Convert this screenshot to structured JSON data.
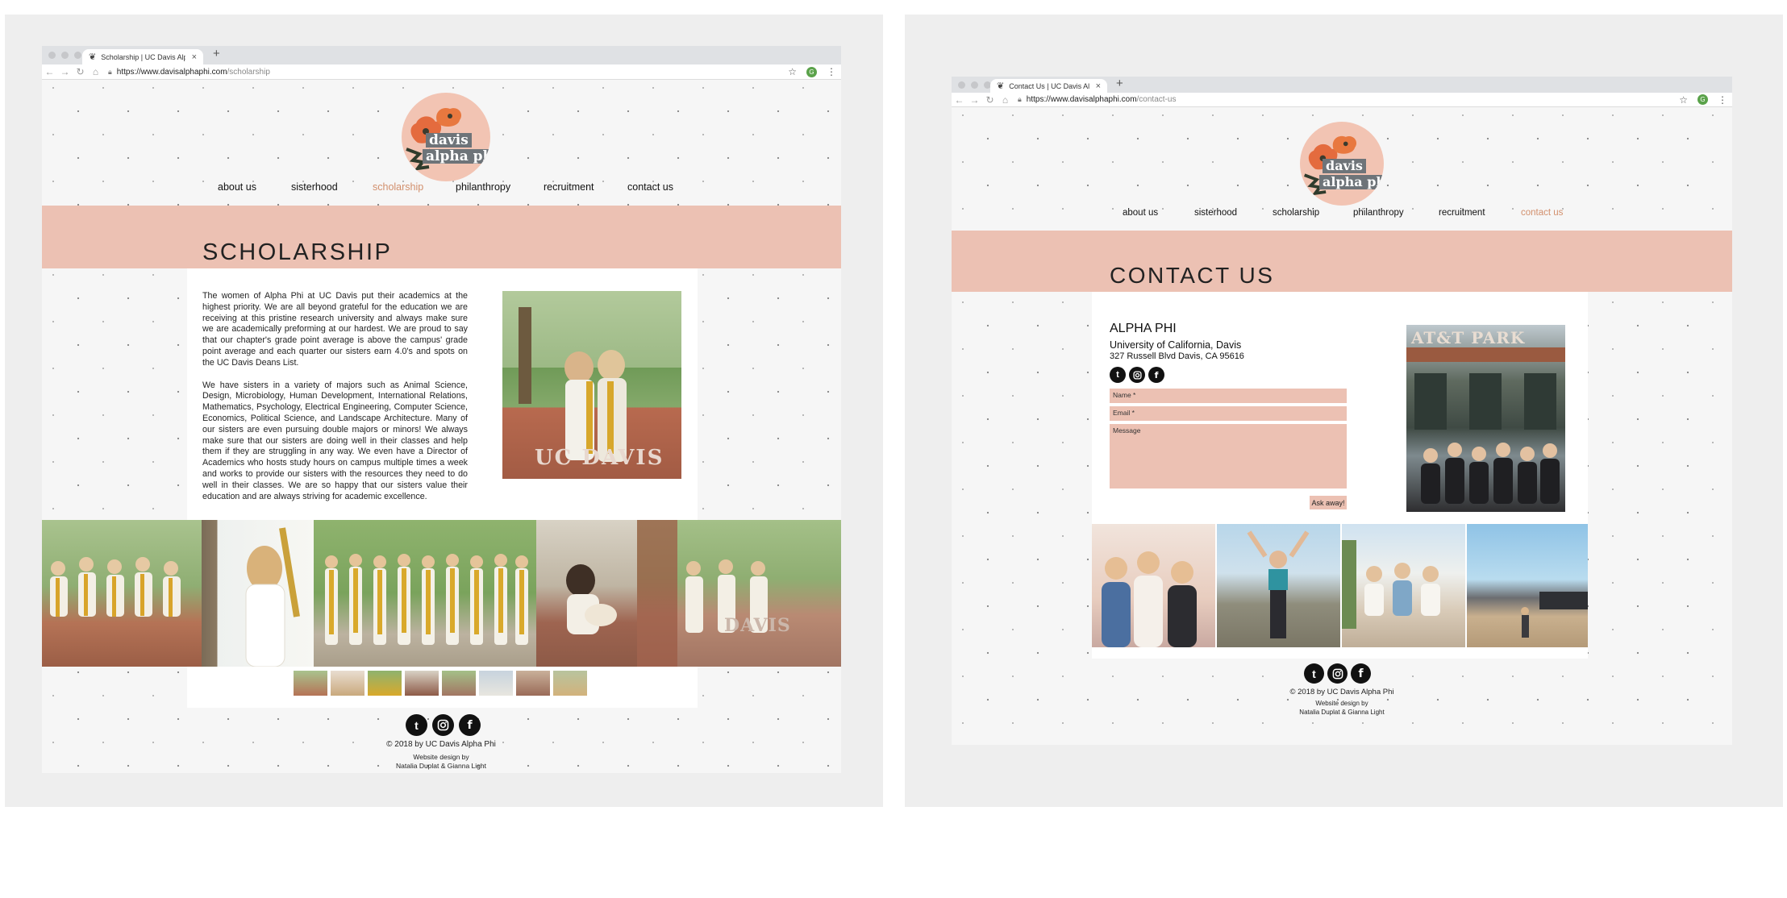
{
  "left": {
    "tab_title": "Scholarship | UC Davis Alpha P",
    "url_host": "https://www.davisalphaphi.com",
    "url_path": "/scholarship",
    "logo": {
      "line1": "davis",
      "line2": "alpha phi"
    },
    "nav": [
      "about us",
      "sisterhood",
      "scholarship",
      "philanthropy",
      "recruitment",
      "contact us"
    ],
    "active_nav": "scholarship",
    "heading": "SCHOLARSHIP",
    "paragraphs": [
      "The women of Alpha Phi at UC Davis put their academics at the highest priority. We are all beyond grateful for the education we are receiving at this pristine research university and always make sure we are academically preforming at our hardest. We are proud to say that our chapter's grade point average is above the campus' grade point average and each quarter our sisters earn 4.0's and spots on the UC Davis Deans List.",
      "We have sisters in a variety of majors such as Animal Science, Design, Microbiology, Human Development, International Relations, Mathematics, Psychology, Electrical Engineering, Computer Science, Economics, Political Science, and Landscape Architecture. Many of our sisters are even pursuing double majors or minors! We always make sure that our sisters are doing well in their classes and help them if they are struggling in any way. We even have a Director of Academics who hosts study hours on campus multiple times a week and works to provide our sisters with the resources they need to do well in their classes. We are so happy that our sisters value their education and are always striving for academic excellence."
    ],
    "photo_sign": "UC DAVIS",
    "gallery_sign": "DAVIS",
    "footer": {
      "copyright": "© 2018 by UC Davis Alpha Phi",
      "credit1": "Website design by",
      "credit2": "Natalia Duplat & Gianna Light"
    }
  },
  "right": {
    "tab_title": "Contact Us | UC Davis Alpha P",
    "url_host": "https://www.davisalphaphi.com",
    "url_path": "/contact-us",
    "logo": {
      "line1": "davis",
      "line2": "alpha phi"
    },
    "nav": [
      "about us",
      "sisterhood",
      "scholarship",
      "philanthropy",
      "recruitment",
      "contact us"
    ],
    "active_nav": "contact us",
    "heading": "CONTACT US",
    "org_name": "ALPHA PHI",
    "university": "University of California, Davis",
    "address": "327 Russell Blvd Davis, CA 95616",
    "form": {
      "name": "Name *",
      "email": "Email *",
      "message": "Message",
      "submit": "Ask away!"
    },
    "photo_sign": "AT&T PARK",
    "footer": {
      "copyright": "© 2018 by UC Davis Alpha Phi",
      "credit1": "Website design by",
      "credit2": "Natalia Duplat & Gianna Light"
    }
  },
  "icons": [
    "tumblr-icon",
    "instagram-icon",
    "facebook-icon",
    "lock-icon",
    "star-icon",
    "back-icon",
    "forward-icon",
    "reload-icon",
    "home-icon"
  ],
  "colors": {
    "accent_band": "#ecc1b3",
    "active_nav": "#d28f6c",
    "logo_circle": "#f2c4b3"
  }
}
